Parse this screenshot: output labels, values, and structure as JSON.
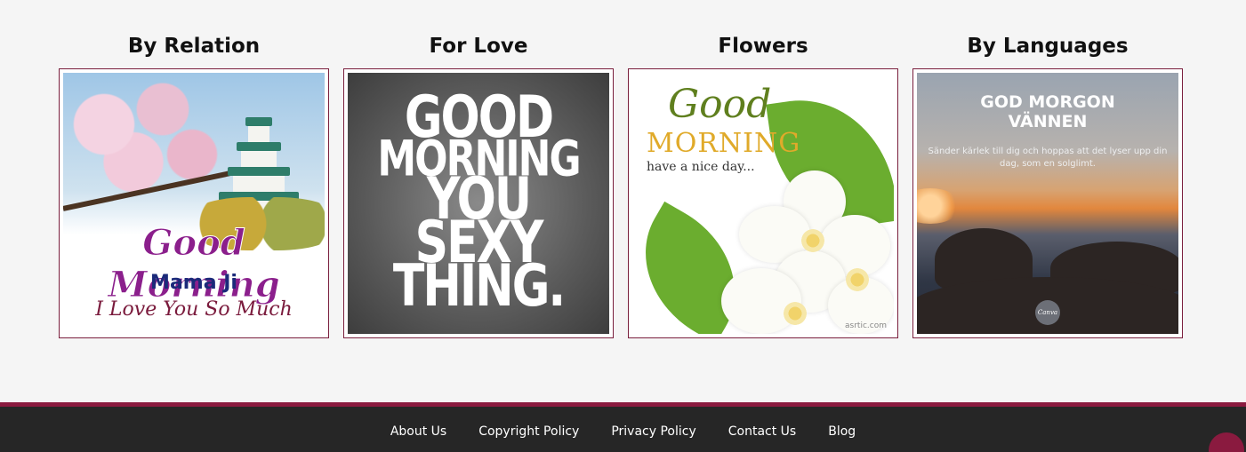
{
  "categories": [
    {
      "title": "By Relation",
      "image": {
        "headline": "Good Morning",
        "name": "Mama Ji",
        "tagline": "I Love You So Much"
      }
    },
    {
      "title": "For Love",
      "image": {
        "lines": [
          "GOOD",
          "MORNING",
          "YOU",
          "SEXY",
          "THING."
        ]
      }
    },
    {
      "title": "Flowers",
      "image": {
        "good": "Good",
        "morning": "MORNING",
        "sub": "have a nice day...",
        "watermark": "asrtic.com"
      }
    },
    {
      "title": "By Languages",
      "image": {
        "headline_1": "GOD MORGON",
        "headline_2": "VÄNNEN",
        "body": "Sänder kärlek till dig och hoppas att det lyser upp din dag, som en solglimt.",
        "badge": "Canva"
      }
    }
  ],
  "footer": {
    "links": [
      "About Us",
      "Copyright Policy",
      "Privacy Policy",
      "Contact Us",
      "Blog"
    ]
  },
  "colors": {
    "accent": "#8a1a3f",
    "footer_bg": "#262626",
    "page_bg": "#f5f5f5"
  }
}
